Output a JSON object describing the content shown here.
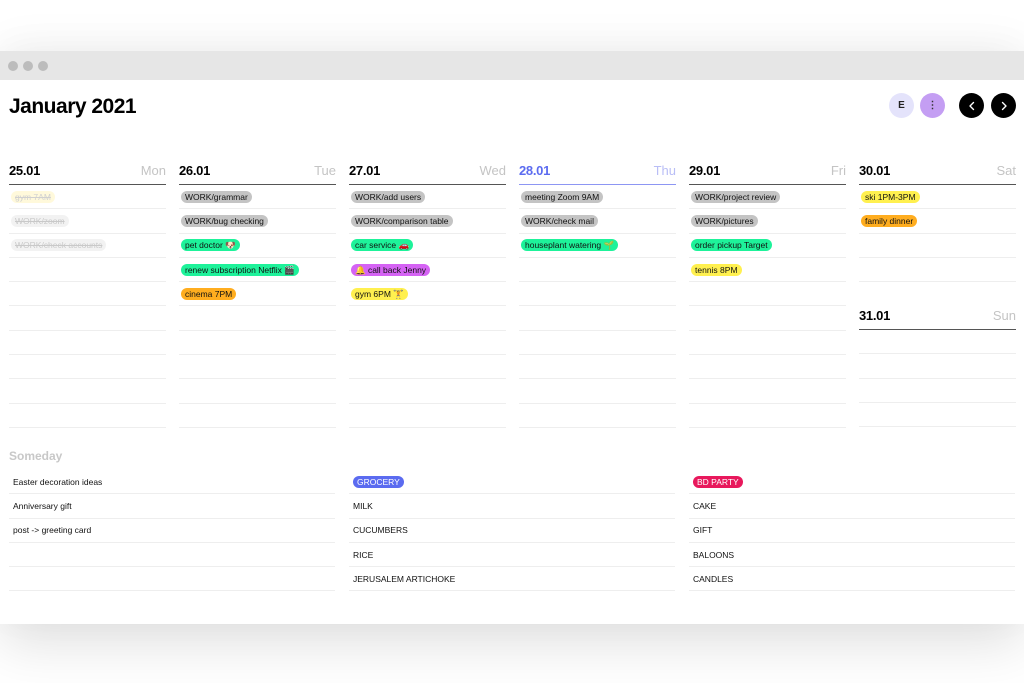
{
  "window": {
    "title_dots": 3
  },
  "header": {
    "title": "January 2021",
    "avatar_initial": "E",
    "more_icon": "⋮",
    "prev_icon": "chevron-left-icon",
    "next_icon": "chevron-right-icon"
  },
  "colors": {
    "today": "#5b6bf0",
    "gray": "#c4c4c4",
    "green": "#1ef29a",
    "orange": "#ffad1f",
    "yellow": "#fff04f",
    "purple": "#d563f4",
    "grocery": "#5b6bf0",
    "bd_party": "#e8185c"
  },
  "days": [
    {
      "date": "25.01",
      "name": "Mon",
      "today": false,
      "events": [
        {
          "label": "gym 7AM",
          "color": "lightyellow",
          "done": true
        },
        {
          "label": "WORK/zoom",
          "color": "lightgray",
          "done": true
        },
        {
          "label": "WORK/check accounts",
          "color": "lightgray",
          "done": true
        }
      ]
    },
    {
      "date": "26.01",
      "name": "Tue",
      "today": false,
      "events": [
        {
          "label": "WORK/grammar",
          "color": "gray"
        },
        {
          "label": "WORK/bug checking",
          "color": "gray"
        },
        {
          "label": "pet doctor 🐶",
          "color": "green"
        },
        {
          "label": "renew subscription Netflix 🎬",
          "color": "green"
        },
        {
          "label": "cinema 7PM",
          "color": "orange"
        }
      ]
    },
    {
      "date": "27.01",
      "name": "Wed",
      "today": false,
      "events": [
        {
          "label": "WORK/add users",
          "color": "gray"
        },
        {
          "label": "WORK/comparison table",
          "color": "gray"
        },
        {
          "label": "car service 🚗",
          "color": "green"
        },
        {
          "label": "🔔 call back Jenny",
          "color": "purple"
        },
        {
          "label": "gym 6PM 🏋",
          "color": "yellow"
        }
      ]
    },
    {
      "date": "28.01",
      "name": "Thu",
      "today": true,
      "events": [
        {
          "label": "meeting Zoom 9AM",
          "color": "gray"
        },
        {
          "label": "WORK/check mail",
          "color": "gray"
        },
        {
          "label": "houseplant watering 🌱",
          "color": "green"
        }
      ]
    },
    {
      "date": "29.01",
      "name": "Fri",
      "today": false,
      "events": [
        {
          "label": "WORK/project review",
          "color": "gray"
        },
        {
          "label": "WORK/pictures",
          "color": "gray"
        },
        {
          "label": "order pickup Target",
          "color": "green"
        },
        {
          "label": "tennis 8PM",
          "color": "yellow"
        }
      ]
    },
    {
      "date": "30.01",
      "name": "Sat",
      "today": false,
      "events": [
        {
          "label": "ski 1PM-3PM",
          "color": "yellow"
        },
        {
          "label": "family dinner",
          "color": "orange"
        }
      ]
    },
    {
      "date": "31.01",
      "name": "Sun",
      "today": false,
      "events": []
    }
  ],
  "someday": {
    "title": "Someday",
    "lists": [
      {
        "tag": null,
        "items": [
          "Easter decoration ideas",
          "Anniversary gift",
          "post -> greeting card",
          "",
          ""
        ]
      },
      {
        "tag": "GROCERY",
        "tag_color": "#5b6bf0",
        "items": [
          "MILK",
          "CUCUMBERS",
          "RICE",
          "JERUSALEM ARTICHOKE"
        ]
      },
      {
        "tag": "BD PARTY",
        "tag_color": "#e8185c",
        "items": [
          "CAKE",
          "GIFT",
          "BALOONS",
          "CANDLES"
        ]
      }
    ]
  }
}
